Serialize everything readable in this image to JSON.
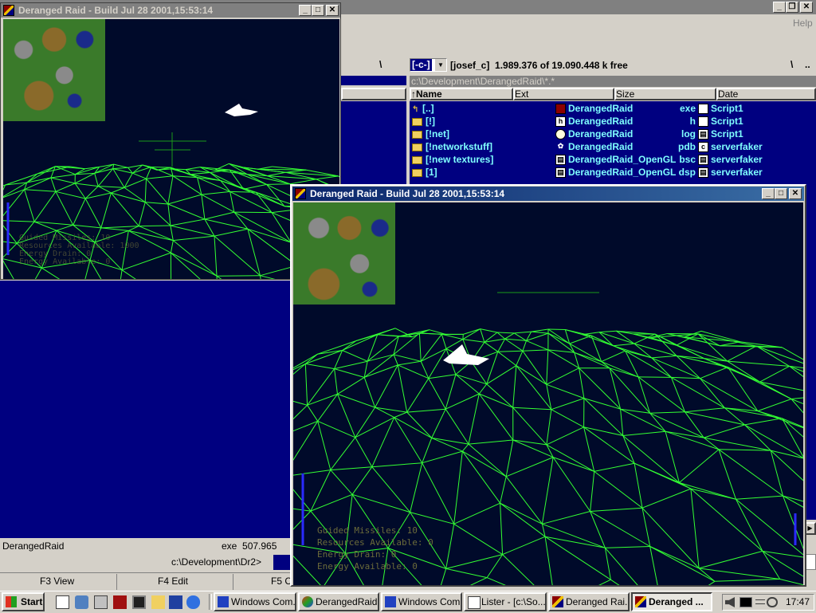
{
  "background_window": {
    "help_menu": "Help",
    "drive_button": "[-c-]",
    "volume_label": "[josef_c]",
    "free_space": "1.989.376 of 19.090.448 k free",
    "path": "c:\\Development\\DerangedRaid\\*.*",
    "columns": {
      "name": "↑Name",
      "ext": "Ext",
      "size": "Size",
      "date": "Date"
    },
    "rows_left": [
      {
        "name": "[..]",
        "icon": "parent-dir-icon"
      },
      {
        "name": "[!]",
        "icon": "folder-icon"
      },
      {
        "name": "[!net]",
        "icon": "folder-icon"
      },
      {
        "name": "[!networkstuff]",
        "icon": "folder-icon"
      },
      {
        "name": "[!new textures]",
        "icon": "folder-icon"
      },
      {
        "name": "[1]",
        "icon": "folder-icon"
      }
    ],
    "rows_mid": [
      {
        "name": "DerangedRaid",
        "ext": "exe",
        "icon": "exe-icon"
      },
      {
        "name": "DerangedRaid",
        "ext": "h",
        "icon": "header-file-icon"
      },
      {
        "name": "DerangedRaid",
        "ext": "log",
        "icon": "log-file-icon"
      },
      {
        "name": "DerangedRaid",
        "ext": "pdb",
        "icon": "pdb-file-icon"
      },
      {
        "name": "DerangedRaid_OpenGL",
        "ext": "bsc",
        "icon": "bsc-file-icon"
      },
      {
        "name": "DerangedRaid_OpenGL",
        "ext": "dsp",
        "icon": "dsp-file-icon"
      }
    ],
    "rows_right": [
      {
        "name": "Script1",
        "icon": "file-icon"
      },
      {
        "name": "Script1",
        "icon": "file-icon"
      },
      {
        "name": "Script1",
        "icon": "script-file-icon"
      },
      {
        "name": "serverfaker",
        "icon": "cpp-file-icon"
      },
      {
        "name": "serverfaker",
        "icon": "project-file-icon"
      },
      {
        "name": "serverfaker",
        "icon": "project-file-icon"
      }
    ],
    "status_name": "DerangedRaid",
    "status_info": "exe  507.965",
    "command_path": "c:\\Development\\Dr2>",
    "fkeys": [
      {
        "label": "F3 View"
      },
      {
        "label": "F4 Edit"
      },
      {
        "label": "F5 C"
      }
    ]
  },
  "game_window_back": {
    "title": "Deranged Raid - Build Jul 28 2001,15:53:14",
    "hud": [
      "Guided Missiles: 10",
      "Resources Available: 1000",
      "Energy Drain: 0",
      "Energy Available: 0"
    ]
  },
  "game_window_front": {
    "title": "Deranged Raid - Build Jul 28 2001,15:53:14",
    "hud": [
      "Guided Missiles: 10",
      "Resources Available: 0",
      "Energy Drain: 0",
      "Energy Available: 0"
    ]
  },
  "taskbar": {
    "start": "Start",
    "buttons": [
      {
        "label": "Windows Com...",
        "pressed": false
      },
      {
        "label": "DerangedRaid...",
        "pressed": false
      },
      {
        "label": "Windows Com...",
        "pressed": false
      },
      {
        "label": "Lister - [c:\\So...",
        "pressed": false
      },
      {
        "label": "Deranged Rai...",
        "pressed": false
      },
      {
        "label": "Deranged ...",
        "pressed": true
      }
    ],
    "clock": "17:47"
  },
  "colors": {
    "wireframe": "#33ff33",
    "title_active": "#0a246a",
    "panel_blue": "#000080",
    "file_text": "#7fffff"
  }
}
